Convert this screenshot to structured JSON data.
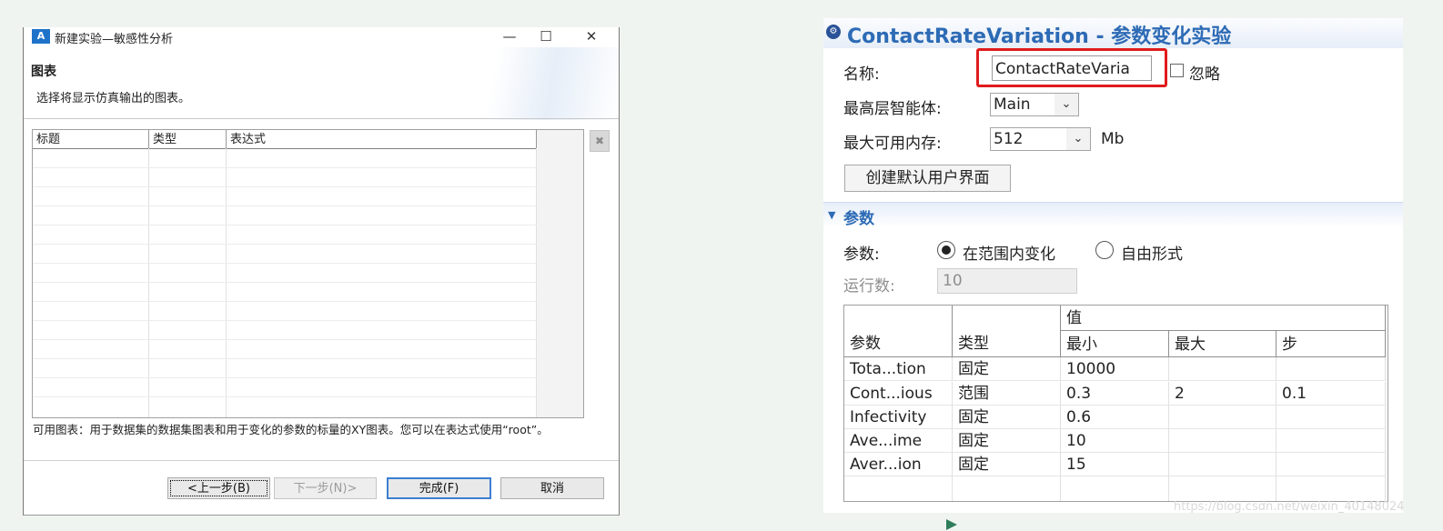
{
  "dialog": {
    "title": "新建实验—敏感性分析",
    "window_buttons": {
      "minimize": "—",
      "maximize": "☐",
      "close": "✕"
    },
    "section_title": "图表",
    "section_desc": "选择将显示仿真输出的图表。",
    "table_headers": [
      "标题",
      "类型",
      "表达式"
    ],
    "delete_button": "✖",
    "info_text": "可用图表：用于数据集的数据集图表和用于变化的参数的标量的XY图表。您可以在表达式使用“root”。",
    "buttons": {
      "back": "<上一步(B)",
      "next": "下一步(N)>",
      "finish": "完成(F)",
      "cancel": "取消"
    }
  },
  "properties": {
    "title": "ContactRateVariation - 参数变化实验",
    "name_label": "名称:",
    "name_value": "ContactRateVaria",
    "ignore_label": "忽略",
    "top_agent_label": "最高层智能体:",
    "top_agent_value": "Main",
    "max_memory_label": "最大可用内存:",
    "max_memory_value": "512",
    "memory_unit": "Mb",
    "create_ui_button": "创建默认用户界面",
    "params_section": "参数",
    "params_label": "参数:",
    "radio_range": "在范围内变化",
    "radio_free": "自由形式",
    "runs_label": "运行数:",
    "runs_value": "10",
    "table": {
      "header_param": "参数",
      "header_type": "类型",
      "header_value": "值",
      "header_min": "最小",
      "header_max": "最大",
      "header_step": "步",
      "rows": [
        {
          "param": "Tota...tion",
          "type": "固定",
          "min": "10000",
          "max": "",
          "step": ""
        },
        {
          "param": "Cont...ious",
          "type": "范围",
          "min": "0.3",
          "max": "2",
          "step": "0.1"
        },
        {
          "param": "Infectivity",
          "type": "固定",
          "min": "0.6",
          "max": "",
          "step": ""
        },
        {
          "param": "Ave...ime",
          "type": "固定",
          "min": "10",
          "max": "",
          "step": ""
        },
        {
          "param": "Aver...ion",
          "type": "固定",
          "min": "15",
          "max": "",
          "step": ""
        }
      ]
    }
  },
  "watermark": "https://blog.csdn.net/weixin_40148024",
  "colors": {
    "accent": "#2d6bb5",
    "highlight": "#e01b1b",
    "dialog_button_border": "#3c7fd2"
  }
}
